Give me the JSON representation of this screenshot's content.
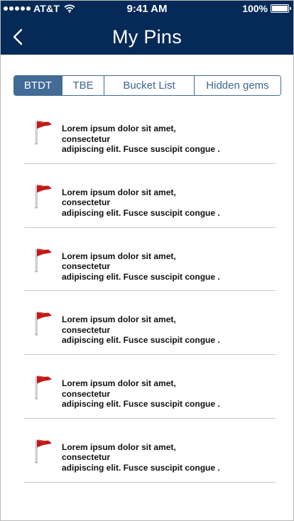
{
  "status_bar": {
    "carrier": "AT&T",
    "time": "9:41 AM",
    "battery": "100%"
  },
  "header": {
    "title": "My Pins",
    "background": "#062a57"
  },
  "tabs": [
    {
      "label": "BTDT",
      "active": true
    },
    {
      "label": "TBE",
      "active": false
    },
    {
      "label": "Bucket List",
      "active": false
    },
    {
      "label": "Hidden gems",
      "active": false
    }
  ],
  "pins": [
    {
      "line1": "Lorem ipsum dolor sit amet, consectetur",
      "line2": "adipiscing elit. Fusce suscipit congue .",
      "icon": "red-flag-icon"
    },
    {
      "line1": "Lorem ipsum dolor sit amet, consectetur",
      "line2": "adipiscing elit. Fusce suscipit congue .",
      "icon": "red-flag-icon"
    },
    {
      "line1": "Lorem ipsum dolor sit amet, consectetur",
      "line2": "adipiscing elit. Fusce suscipit congue .",
      "icon": "red-flag-icon"
    },
    {
      "line1": "Lorem ipsum dolor sit amet, consectetur",
      "line2": "adipiscing elit. Fusce suscipit congue .",
      "icon": "red-flag-icon"
    },
    {
      "line1": "Lorem ipsum dolor sit amet, consectetur",
      "line2": "adipiscing elit. Fusce suscipit congue .",
      "icon": "red-flag-icon"
    },
    {
      "line1": "Lorem ipsum dolor sit amet, consectetur",
      "line2": "adipiscing elit. Fusce suscipit congue .",
      "icon": "red-flag-icon"
    }
  ],
  "colors": {
    "accent": "#426b96",
    "flag": "#c11a1a"
  }
}
